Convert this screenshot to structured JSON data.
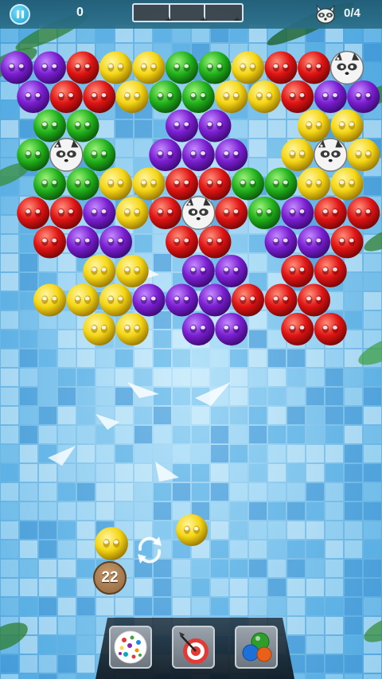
{
  "hud": {
    "score": "0",
    "goal_progress": "0/4",
    "pause_icon": "pause-icon",
    "goal_icon": "raccoon-icon",
    "star_progress_fraction": 0,
    "star_marks": [
      "star-icon",
      "star-icon",
      "star-icon"
    ]
  },
  "colors": {
    "purple": "#7b1fd1",
    "red": "#e01414",
    "yellow": "#f5d614",
    "green": "#22b21c",
    "raccoon": "#f1f1f1",
    "tile_light": "#a9dcf7",
    "tile_dark": "#3d94d6"
  },
  "grid": {
    "rows": [
      [
        "purple",
        "purple",
        "red",
        "yellow",
        "yellow",
        "green",
        "green",
        "yellow",
        "red",
        "red",
        "raccoon"
      ],
      [
        "purple",
        "red",
        "red",
        "yellow",
        "green",
        "green",
        "yellow",
        "yellow",
        "red",
        "purple",
        "purple"
      ],
      [
        "",
        "green",
        "green",
        "",
        "",
        "purple",
        "purple",
        "",
        "",
        "yellow",
        "yellow"
      ],
      [
        "green",
        "raccoon",
        "green",
        "",
        "purple",
        "purple",
        "purple",
        "",
        "yellow",
        "raccoon",
        "yellow"
      ],
      [
        "",
        "green",
        "green",
        "yellow",
        "yellow",
        "red",
        "red",
        "green",
        "green",
        "yellow",
        "yellow"
      ],
      [
        "red",
        "red",
        "purple",
        "yellow",
        "red",
        "raccoon",
        "red",
        "green",
        "purple",
        "red",
        "red"
      ],
      [
        "",
        "red",
        "purple",
        "purple",
        "",
        "red",
        "red",
        "",
        "purple",
        "purple",
        "red"
      ],
      [
        "",
        "",
        "yellow",
        "yellow",
        "",
        "purple",
        "purple",
        "",
        "red",
        "red",
        ""
      ],
      [
        "",
        "yellow",
        "yellow",
        "yellow",
        "purple",
        "purple",
        "purple",
        "red",
        "red",
        "red",
        ""
      ],
      [
        "",
        "",
        "yellow",
        "yellow",
        "",
        "purple",
        "purple",
        "",
        "red",
        "red",
        ""
      ]
    ]
  },
  "shooter": {
    "current_color": "yellow",
    "next_color": "yellow",
    "moves_left": "22",
    "swap_icon": "swap-arrows-icon"
  },
  "boosters": [
    {
      "name": "rainbow-bubble-icon"
    },
    {
      "name": "target-dart-icon"
    },
    {
      "name": "color-bubbles-icon"
    }
  ]
}
